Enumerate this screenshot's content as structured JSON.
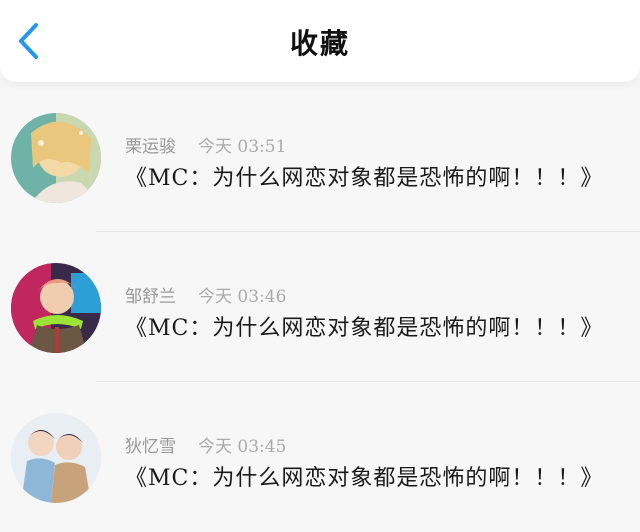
{
  "header": {
    "title": "收藏",
    "back_icon": "chevron-left-icon",
    "accent": "#2196f3"
  },
  "favorites": [
    {
      "name": "栗运骏",
      "time": "今天 03:51",
      "message": "《MC：为什么网恋对象都是恐怖的啊！！！》"
    },
    {
      "name": "邹舒兰",
      "time": "今天 03:46",
      "message": "《MC：为什么网恋对象都是恐怖的啊！！！》"
    },
    {
      "name": "狄忆雪",
      "time": "今天 03:45",
      "message": "《MC：为什么网恋对象都是恐怖的啊！！！》"
    }
  ]
}
